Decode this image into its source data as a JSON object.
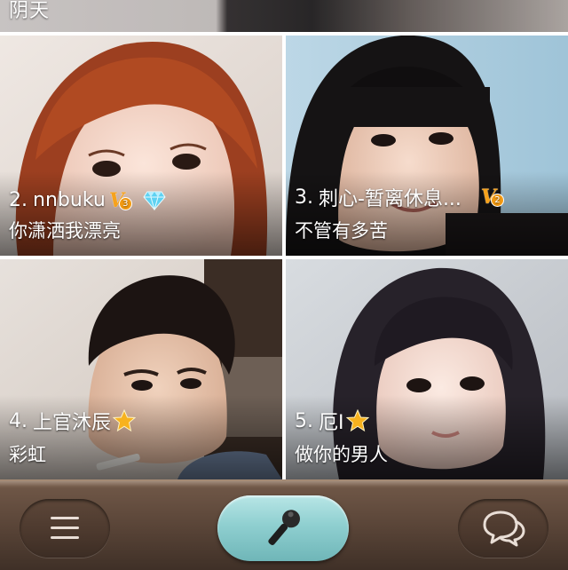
{
  "top_card": {
    "caption": "阴天"
  },
  "cards": [
    {
      "rank": "2.",
      "name": "nnbuku",
      "level": "3",
      "signature": "你潇洒我漂亮"
    },
    {
      "rank": "3.",
      "name": "刺心-暂离休息...",
      "level": "2",
      "signature": "不管有多苦"
    },
    {
      "rank": "4.",
      "name": "上官沐辰",
      "signature": "彩虹"
    },
    {
      "rank": "5.",
      "name": "厄I",
      "signature": "做你的男人"
    }
  ],
  "icons": {
    "vip_badge": "vip-badge-icon",
    "diamond": "diamond-icon",
    "star": "star-icon",
    "menu": "menu-icon",
    "microphone": "microphone-icon",
    "chat": "chat-bubbles-icon"
  },
  "colors": {
    "toolbar": "#5a4538",
    "mic_button": "#8fcfd0",
    "vip_gold": "#f6a21c",
    "star_gold": "#f7b21e",
    "diamond_blue": "#5fd2f2"
  }
}
